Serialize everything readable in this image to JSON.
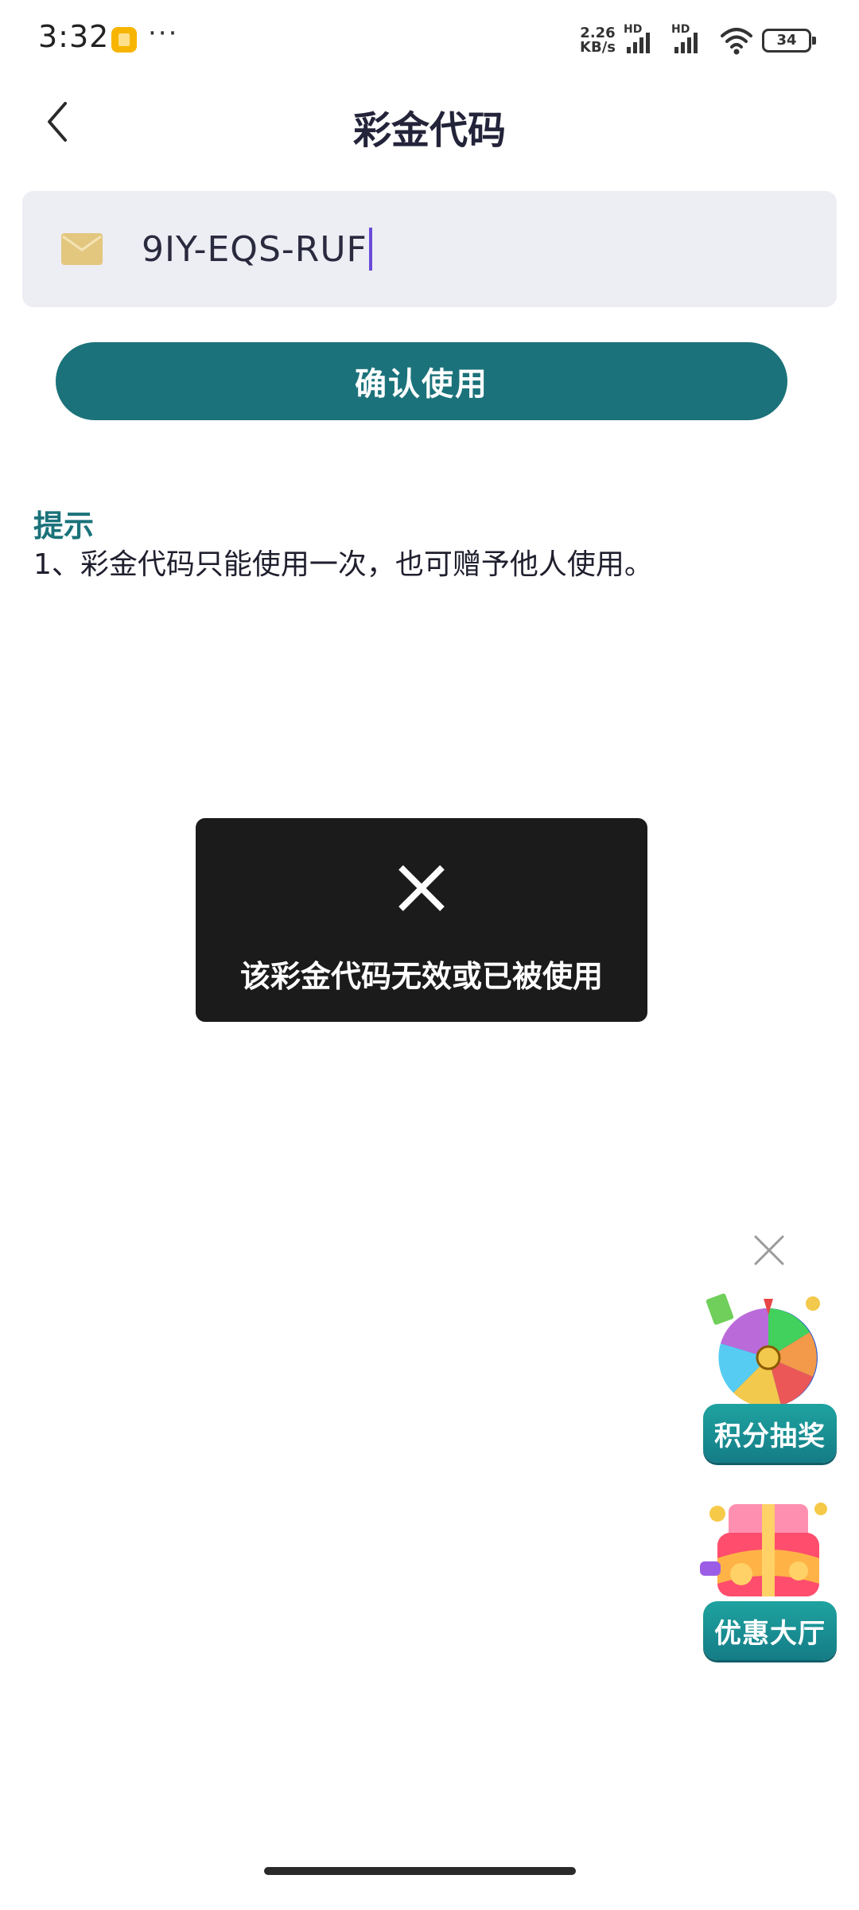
{
  "status_bar": {
    "time": "3:32",
    "more": "···",
    "net_speed_value": "2.26",
    "net_speed_unit": "KB/s",
    "sim1_label": "HD",
    "sim2_label": "HD",
    "battery": "34",
    "icons": [
      "app-notification-icon",
      "signal-icon",
      "wifi-icon",
      "battery-icon"
    ]
  },
  "header": {
    "title": "彩金代码",
    "back_icon": "chevron-left-icon"
  },
  "code_field": {
    "icon": "envelope-icon",
    "value": "9IY-EQS-RUF"
  },
  "confirm_button": {
    "label": "确认使用"
  },
  "tips": {
    "title": "提示",
    "items": [
      "1、彩金代码只能使用一次，也可赠予他人使用。"
    ]
  },
  "toast": {
    "icon": "close-x-icon",
    "message": "该彩金代码无效或已被使用"
  },
  "floating_widgets": {
    "close_icon": "close-icon",
    "items": [
      {
        "label": "积分抽奖",
        "art": "prize-wheel-icon"
      },
      {
        "label": "优惠大厅",
        "art": "gift-box-icon"
      }
    ]
  },
  "colors": {
    "accent": "#1b727a",
    "input_bg": "#ededf4",
    "toast_bg": "#1b1b1b",
    "tip_title": "#1b727a",
    "caret": "#6a4bd8",
    "envelope": "#e3c77f"
  }
}
